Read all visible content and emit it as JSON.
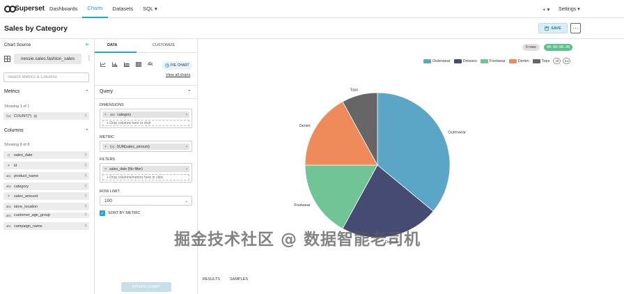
{
  "nav": {
    "brand": "Superset",
    "items": [
      {
        "label": "Dashboards",
        "active": false
      },
      {
        "label": "Charts",
        "active": true
      },
      {
        "label": "Datasets",
        "active": false
      },
      {
        "label": "SQL ▾",
        "active": false
      }
    ],
    "plus": "+ ▾",
    "settings": "Settings ▾"
  },
  "header": {
    "title": "Sales by Category",
    "save_label": "SAVE",
    "more": "···"
  },
  "left": {
    "chart_source": "Chart Source",
    "dataset": "nessie.sales.fashion_sales",
    "search_placeholder": "Search Metrics & Columns",
    "metrics_title": "Metrics",
    "metrics_showing": "Showing 1 of 1",
    "metrics": [
      {
        "type": "f(x)",
        "name": "COUNT(*)"
      }
    ],
    "columns_title": "Columns",
    "columns_showing": "Showing 8 of 8",
    "columns": [
      {
        "type": "◷",
        "name": "sales_date"
      },
      {
        "type": "#",
        "name": "id"
      },
      {
        "type": "abc",
        "name": "product_name"
      },
      {
        "type": "abc",
        "name": "category"
      },
      {
        "type": "#",
        "name": "sales_amount"
      },
      {
        "type": "abc",
        "name": "store_location"
      },
      {
        "type": "abc",
        "name": "customer_age_group"
      },
      {
        "type": "abc",
        "name": "campaign_name"
      }
    ]
  },
  "mid": {
    "tab_data": "DATA",
    "tab_customize": "CUSTOMIZE",
    "viz_4k": "4k",
    "pie_pill": "PIE CHART",
    "view_all": "View all charts",
    "query_title": "Query",
    "dimensions_label": "DIMENSIONS",
    "dimension_chip": {
      "x": "×",
      "type": "abc",
      "name": "category"
    },
    "dimension_drop": "+ Drop columns here or click",
    "metric_label": "METRIC",
    "metric_chip": {
      "x": "×",
      "type": "f(x)",
      "name": "SUM(sales_amount)"
    },
    "filters_label": "FILTERS",
    "filter_chip": {
      "x": "×",
      "name": "sales_date (No filter)"
    },
    "filter_drop": "+ Drop columns/metrics here or click",
    "row_limit_label": "ROW LIMIT",
    "row_limit_value": "100",
    "sort_by_metric": "SORT BY METRIC",
    "update_chart": "UPDATE CHART"
  },
  "right": {
    "rows_badge": "5 rows",
    "time_badge": "00:00:00.49",
    "legend_all": "All",
    "legend_inv": "Inv",
    "tab_results": "RESULTS",
    "tab_samples": "SAMPLES"
  },
  "chart_data": {
    "type": "pie",
    "categories": [
      "Outerwear",
      "Dresses",
      "Footwear",
      "Denim",
      "Tops"
    ],
    "values": [
      36,
      22,
      17,
      17,
      8
    ],
    "colors": [
      "#5ba6c6",
      "#454b73",
      "#70c495",
      "#ef8a5a",
      "#666666"
    ]
  },
  "watermark": "掘金技术社区 @ 数据智能老司机"
}
